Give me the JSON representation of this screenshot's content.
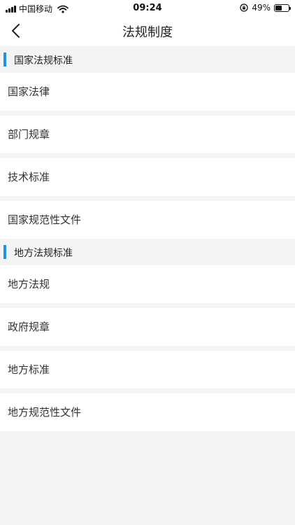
{
  "status_bar": {
    "carrier": "中国移动",
    "time": "09:24",
    "battery": "49%",
    "battery_level": 0.49
  },
  "header": {
    "title": "法规制度"
  },
  "sections": [
    {
      "title": "国家法规标准",
      "items": [
        "国家法律",
        "部门规章",
        "技术标准",
        "国家规范性文件"
      ]
    },
    {
      "title": "地方法规标准",
      "items": [
        "地方法规",
        "政府规章",
        "地方标准",
        "地方规范性文件"
      ]
    }
  ],
  "colors": {
    "accent": "#1a96e0",
    "background": "#f4f4f4"
  },
  "icons": {
    "back": "chevron-left-icon",
    "wifi": "wifi-icon",
    "lock": "orientation-lock-icon",
    "battery": "battery-icon"
  }
}
